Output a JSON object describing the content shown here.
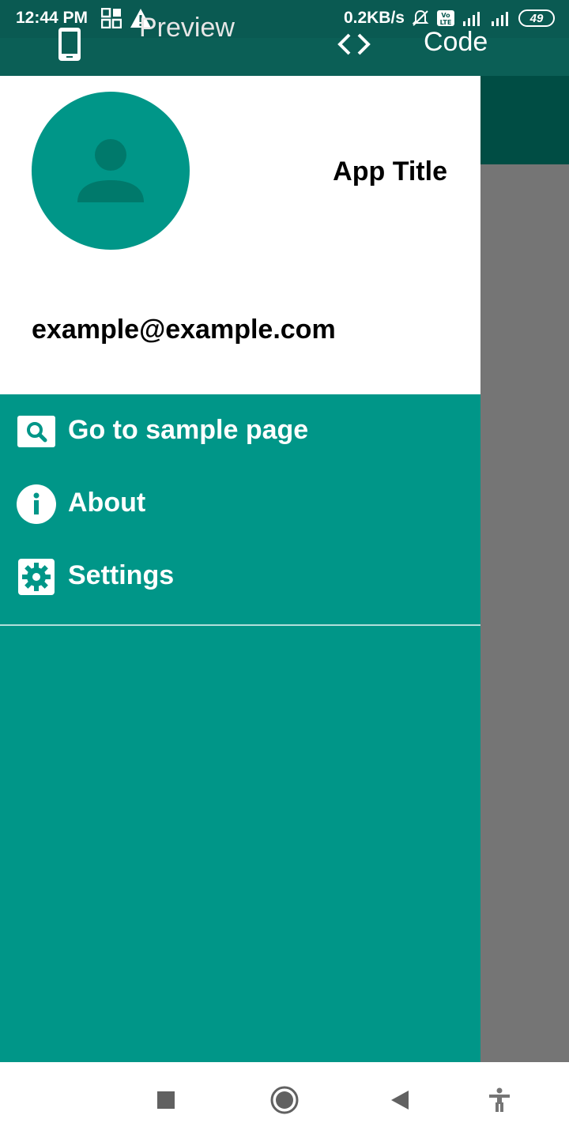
{
  "status_bar": {
    "time": "12:44 PM",
    "network_speed": "0.2KB/s",
    "battery": "49",
    "icons": [
      "grid-icon",
      "warning-icon",
      "mute-icon",
      "volte-icon",
      "signal-icon",
      "signal-icon"
    ]
  },
  "tabs": {
    "preview_label": "Preview",
    "code_label": "Code"
  },
  "drawer": {
    "app_title": "App Title",
    "email": "example@example.com",
    "items": [
      {
        "label": "Go to sample page",
        "icon": "search-icon"
      },
      {
        "label": "About",
        "icon": "info-icon"
      },
      {
        "label": "Settings",
        "icon": "settings-icon"
      }
    ]
  },
  "colors": {
    "primary": "#009688",
    "primary_dark": "#004d44",
    "scrim": "#757575"
  }
}
